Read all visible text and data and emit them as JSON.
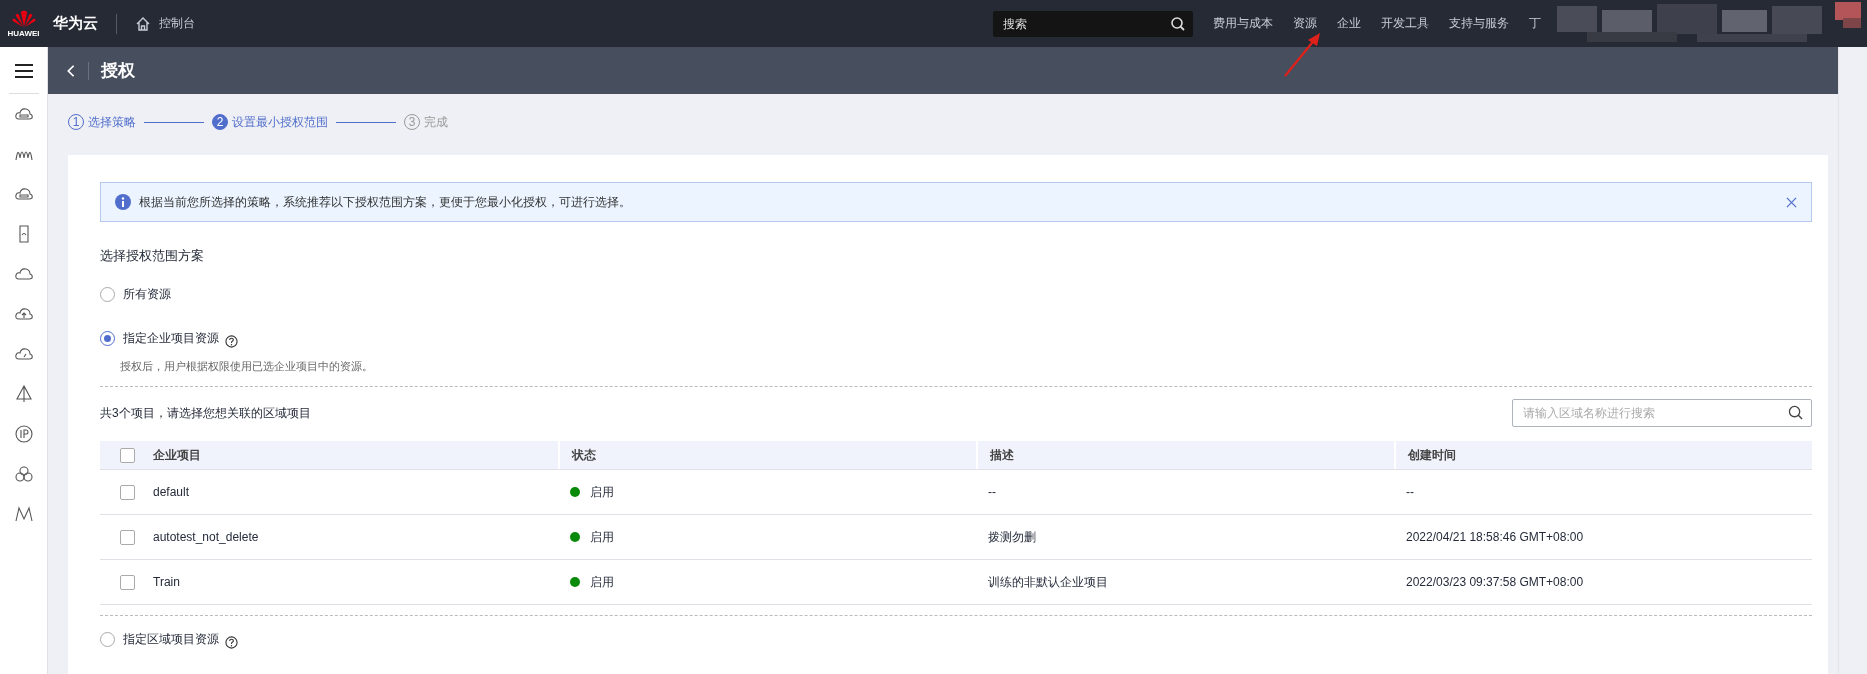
{
  "topbar": {
    "brand": "华为云",
    "logo_text": "HUAWEI",
    "console": "控制台",
    "search": {
      "placeholder": "搜索"
    },
    "nav": [
      {
        "label": "费用与成本"
      },
      {
        "label": "资源"
      },
      {
        "label": "企业"
      },
      {
        "label": "开发工具"
      },
      {
        "label": "支持与服务"
      },
      {
        "label": "丁"
      }
    ]
  },
  "header": {
    "title": "授权"
  },
  "steps": [
    {
      "number": "1",
      "label": "选择策略",
      "completed": true,
      "selected": false
    },
    {
      "number": "2",
      "label": "设置最小授权范围",
      "completed": false,
      "selected": true
    },
    {
      "number": "3",
      "label": "完成",
      "completed": false,
      "selected": false
    }
  ],
  "alert": {
    "text": "根据当前您所选择的策略，系统推荐以下授权范围方案，更便于您最小化授权，可进行选择。"
  },
  "section_title": "选择授权范围方案",
  "options": [
    {
      "label": "所有资源",
      "selected": false,
      "help": false
    },
    {
      "label": "指定企业项目资源",
      "selected": true,
      "help": true,
      "description": "授权后，用户根据权限使用已选企业项目中的资源。"
    },
    {
      "label": "指定区域项目资源",
      "selected": false,
      "help": true
    }
  ],
  "table": {
    "count_text": "共3个项目，请选择您想关联的区域项目",
    "search": {
      "placeholder": "请输入区域名称进行搜索"
    },
    "columns": [
      "企业项目",
      "状态",
      "描述",
      "创建时间"
    ],
    "header_checked": false,
    "rows": [
      {
        "checked": false,
        "name": "default",
        "status": "启用",
        "color": "#0a8a0a",
        "description": "--",
        "created": "--"
      },
      {
        "checked": false,
        "name": "autotest_not_delete",
        "status": "启用",
        "color": "#0a8a0a",
        "description": "拨测勿删",
        "created": "2022/04/21 18:58:46 GMT+08:00"
      },
      {
        "checked": false,
        "name": "Train",
        "status": "启用",
        "color": "#0a8a0a",
        "description": "训练的非默认企业项目",
        "created": "2022/03/23 09:37:58 GMT+08:00"
      }
    ]
  }
}
